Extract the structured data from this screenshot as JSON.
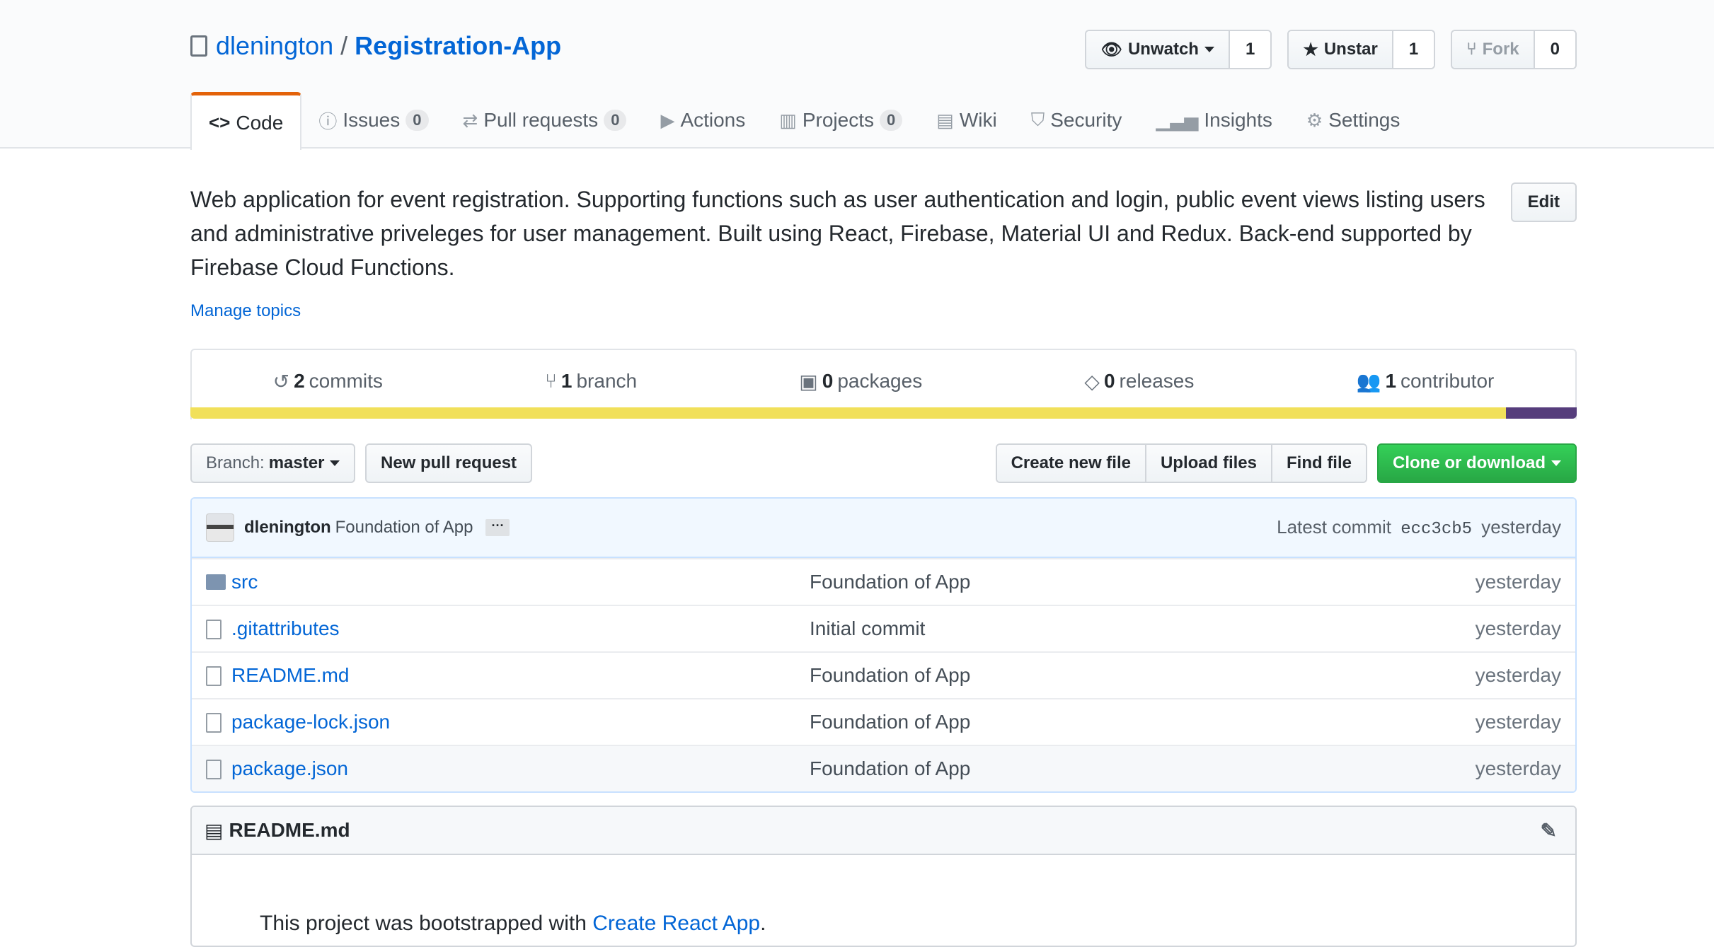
{
  "repo": {
    "owner": "dlenington",
    "separator": "/",
    "name": "Registration-App"
  },
  "watch": {
    "label": "Unwatch",
    "count": "1"
  },
  "star": {
    "label": "Unstar",
    "count": "1"
  },
  "fork": {
    "label": "Fork",
    "count": "0"
  },
  "tabs": [
    {
      "label": "Code",
      "icon": "code-icon"
    },
    {
      "label": "Issues",
      "count": "0",
      "icon": "issue-icon"
    },
    {
      "label": "Pull requests",
      "count": "0",
      "icon": "pull-request-icon"
    },
    {
      "label": "Actions",
      "icon": "play-icon"
    },
    {
      "label": "Projects",
      "count": "0",
      "icon": "project-icon"
    },
    {
      "label": "Wiki",
      "icon": "book-icon"
    },
    {
      "label": "Security",
      "icon": "shield-icon"
    },
    {
      "label": "Insights",
      "icon": "graph-icon"
    },
    {
      "label": "Settings",
      "icon": "gear-icon"
    }
  ],
  "description": "Web application for event registration. Supporting functions such as user authentication and login, public event views listing users and administrative priveleges for user management. Built using React, Firebase, Material UI and Redux. Back-end supported by Firebase Cloud Functions.",
  "edit_label": "Edit",
  "manage_topics": "Manage topics",
  "summary": {
    "commits": {
      "num": "2",
      "label": "commits"
    },
    "branches": {
      "num": "1",
      "label": "branch"
    },
    "packages": {
      "num": "0",
      "label": "packages"
    },
    "releases": {
      "num": "0",
      "label": "releases"
    },
    "contributors": {
      "num": "1",
      "label": "contributor"
    }
  },
  "languages": [
    {
      "color": "#f1e05a",
      "share": 0.949
    },
    {
      "color": "#563d7c",
      "share": 0.051
    }
  ],
  "branch_select": {
    "prefix": "Branch:",
    "value": "master"
  },
  "new_pr": "New pull request",
  "file_actions": {
    "create": "Create new file",
    "upload": "Upload files",
    "find": "Find file"
  },
  "clone": "Clone or download",
  "commit": {
    "author": "dlenington",
    "message": "Foundation of App",
    "ellipsis": "···",
    "latest_label": "Latest commit",
    "sha": "ecc3cb5",
    "age": "yesterday"
  },
  "files": [
    {
      "type": "dir",
      "name": "src",
      "message": "Foundation of App",
      "age": "yesterday"
    },
    {
      "type": "file",
      "name": ".gitattributes",
      "message": "Initial commit",
      "age": "yesterday"
    },
    {
      "type": "file",
      "name": "README.md",
      "message": "Foundation of App",
      "age": "yesterday"
    },
    {
      "type": "file",
      "name": "package-lock.json",
      "message": "Foundation of App",
      "age": "yesterday"
    },
    {
      "type": "file",
      "name": "package.json",
      "message": "Foundation of App",
      "age": "yesterday"
    }
  ],
  "readme": {
    "title": "README.md",
    "body_prefix": "This project was bootstrapped with",
    "body_link": "Create React App",
    "body_suffix": "."
  }
}
